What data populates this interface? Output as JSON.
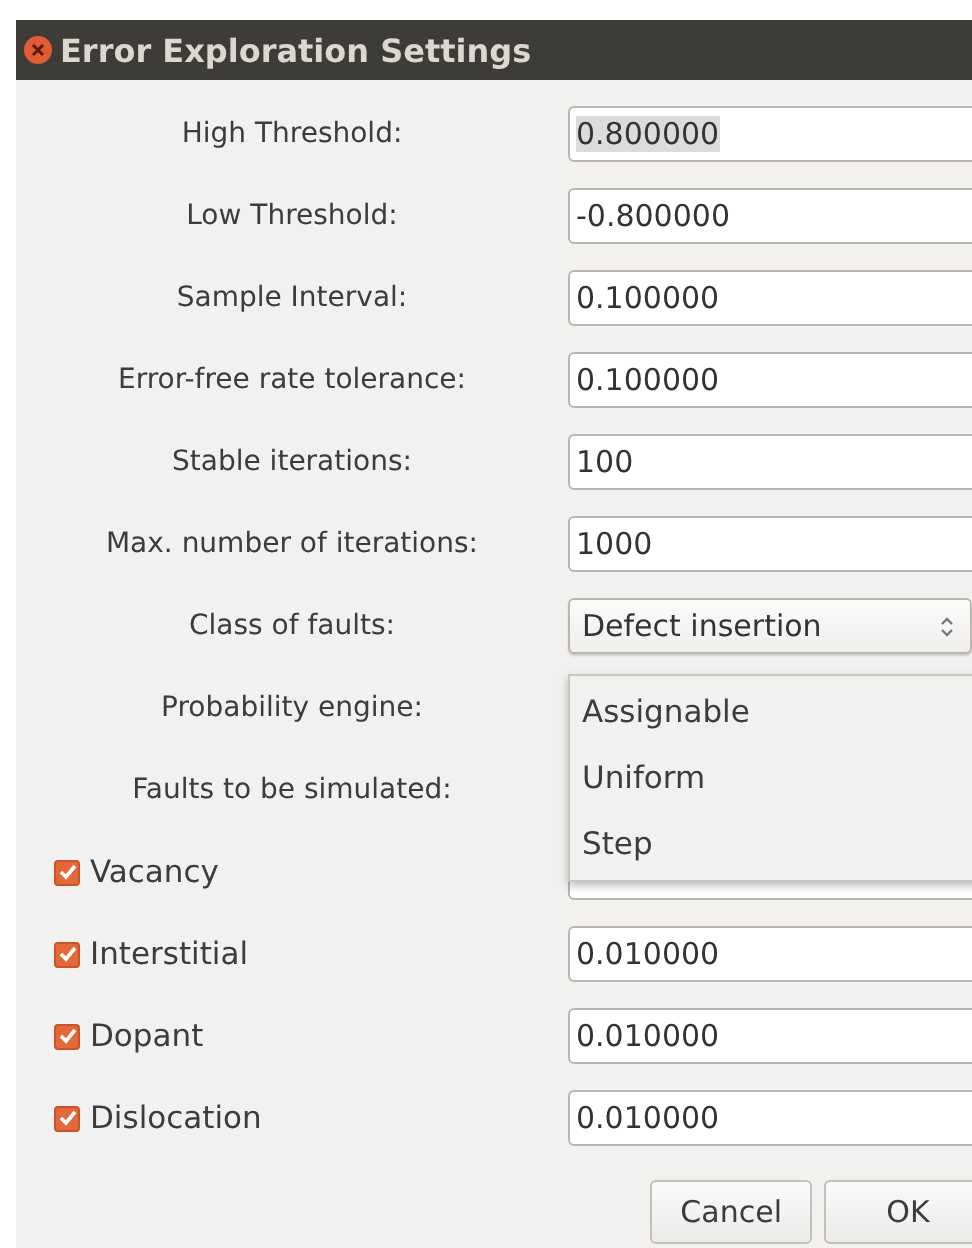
{
  "window": {
    "title": "Error Exploration Settings"
  },
  "settings": [
    {
      "label": "High Threshold:",
      "kind": "text",
      "value": "0.800000",
      "highlighted": true
    },
    {
      "label": "Low Threshold:",
      "kind": "text",
      "value": "-0.800000",
      "highlighted": false
    },
    {
      "label": "Sample Interval:",
      "kind": "text",
      "value": "0.100000",
      "highlighted": false
    },
    {
      "label": "Error-free rate tolerance:",
      "kind": "text",
      "value": "0.100000",
      "highlighted": false
    },
    {
      "label": "Stable iterations:",
      "kind": "text",
      "value": "100",
      "highlighted": false
    },
    {
      "label": "Max. number of iterations:",
      "kind": "text",
      "value": "1000",
      "highlighted": false
    },
    {
      "label": "Class of faults:",
      "kind": "combo",
      "value": "Defect insertion"
    },
    {
      "label": "Probability engine:",
      "kind": "label"
    },
    {
      "label": "Faults to be simulated:",
      "kind": "label"
    }
  ],
  "faults": [
    {
      "label": "Vacancy",
      "checked": true
    },
    {
      "label": "Interstitial",
      "checked": true,
      "value": "0.010000"
    },
    {
      "label": "Dopant",
      "checked": true,
      "value": "0.010000"
    },
    {
      "label": "Dislocation",
      "checked": true,
      "value": "0.010000"
    }
  ],
  "dropdown": {
    "options": [
      "Assignable",
      "Uniform",
      "Step"
    ]
  },
  "buttons": [
    "Cancel",
    "OK"
  ]
}
